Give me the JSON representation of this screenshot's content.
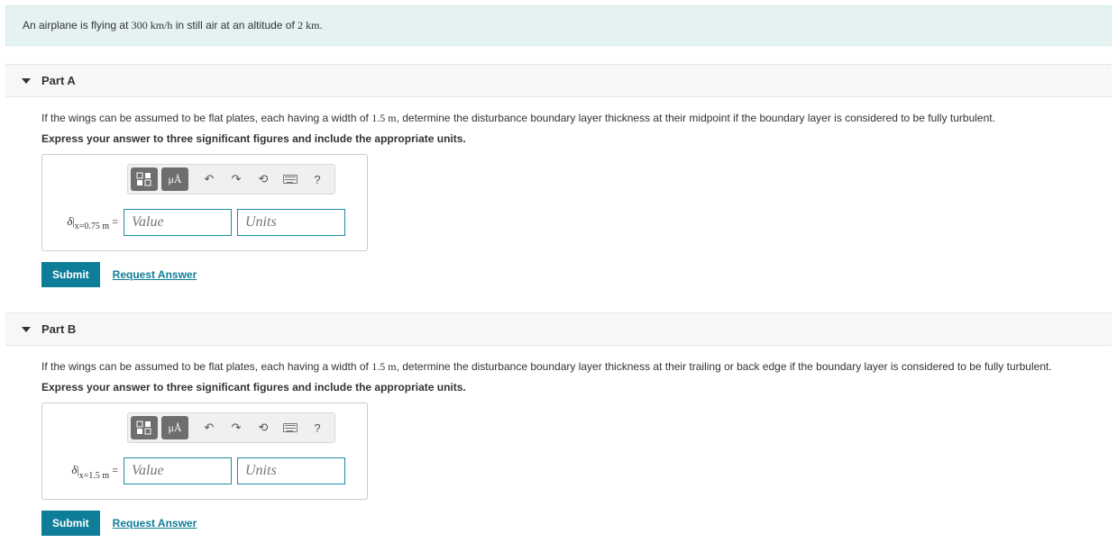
{
  "intro": {
    "pre": "An airplane is flying at ",
    "speed": "300 km/h",
    "mid": " in still air at an altitude of ",
    "alt": "2 km",
    "post": "."
  },
  "parts": [
    {
      "title": "Part A",
      "question_pre": "If the wings can be assumed to be flat plates, each having a width of ",
      "width": "1.5 m",
      "question_post": ", determine the disturbance boundary layer thickness at their midpoint if the boundary layer is considered to be fully turbulent.",
      "instruction": "Express your answer to three significant figures and include the appropriate units.",
      "lhs_sub": "x=0.75 m",
      "value_placeholder": "Value",
      "units_placeholder": "Units",
      "submit": "Submit",
      "request": "Request Answer"
    },
    {
      "title": "Part B",
      "question_pre": "If the wings can be assumed to be flat plates, each having a width of ",
      "width": "1.5 m",
      "question_post": ", determine the disturbance boundary layer thickness at their trailing or back edge if the boundary layer is considered to be fully turbulent.",
      "instruction": "Express your answer to three significant figures and include the appropriate units.",
      "lhs_sub": "x=1.5 m",
      "value_placeholder": "Value",
      "units_placeholder": "Units",
      "submit": "Submit",
      "request": "Request Answer"
    }
  ],
  "toolbar": {
    "templates_label": "templates",
    "special_label": "μÅ",
    "undo_label": "↶",
    "redo_label": "↷",
    "reset_label": "⟲",
    "keyboard_label": "keyboard",
    "help_label": "?"
  }
}
